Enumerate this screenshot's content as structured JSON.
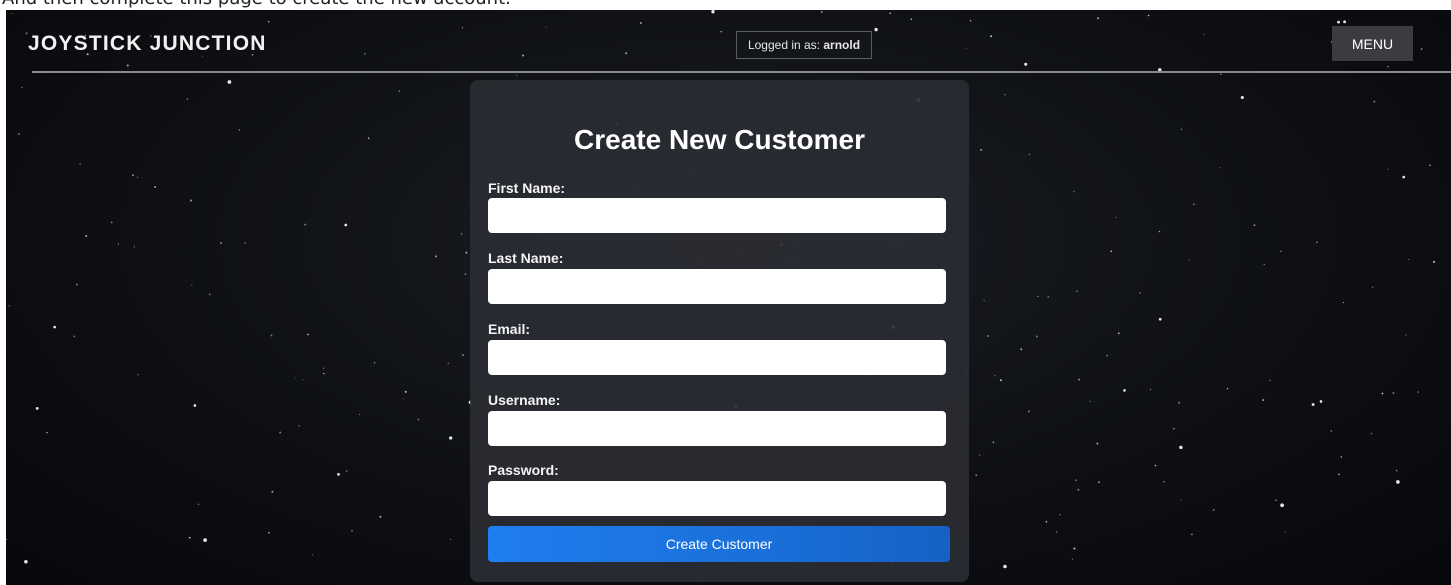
{
  "caption": "And then complete this page to create the new account.",
  "header": {
    "brand": "JOYSTICK JUNCTION",
    "login_prefix": "Logged in as: ",
    "login_user": "arnold",
    "menu_label": "MENU"
  },
  "form": {
    "title": "Create New Customer",
    "fields": [
      {
        "label": "First Name:",
        "value": ""
      },
      {
        "label": "Last Name:",
        "value": ""
      },
      {
        "label": "Email:",
        "value": ""
      },
      {
        "label": "Username:",
        "value": ""
      },
      {
        "label": "Password:",
        "value": ""
      }
    ],
    "submit_label": "Create Customer"
  },
  "colors": {
    "background": "#0e1014",
    "card": "#2a2d33",
    "menu_button": "#3a3c40",
    "submit_button": "#1f7ef0",
    "text": "#ffffff"
  }
}
